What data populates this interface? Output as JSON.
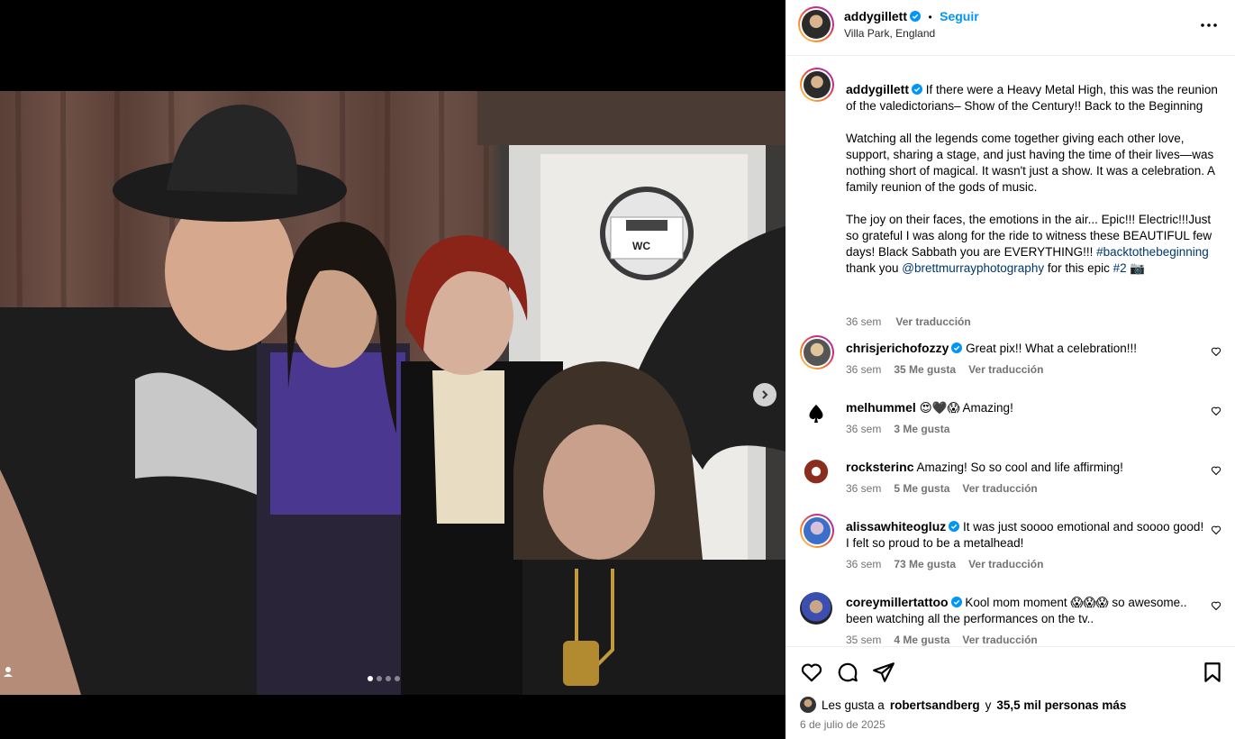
{
  "post": {
    "username": "addygillett",
    "separator": "•",
    "follow_label": "Seguir",
    "location": "Villa Park, England",
    "caption_p1": "If there were a Heavy Metal High, this was the reunion of the valedictorians– Show of the Century!! Back to the Beginning",
    "caption_p2": "Watching all the legends come together giving each other love, support, sharing a stage, and just having the time of their lives—was nothing short of magical. It wasn't just a show. It was a celebration. A family reunion of the gods of music.",
    "caption_p3a": "The joy on their faces, the emotions in the air... Epic!!! Electric!!!Just so grateful I was along for the ride to witness these BEAUTIFUL few days! Black Sabbath you are EVERYTHING!!! ",
    "hashtag1": "#backtothebeginning",
    "caption_p3b": " thank you ",
    "mention": "@brettmurrayphotography",
    "caption_p3c": " for this epic ",
    "hashtag2": "#2",
    "caption_emoji": " 📷",
    "caption_time": "36 sem",
    "caption_translate": "Ver traducción"
  },
  "photo": {
    "sign_text": "WC",
    "slide_count": 4,
    "active_slide": 1
  },
  "comments": [
    {
      "user": "chrisjerichofozzy",
      "verified": true,
      "text": "Great pix!! What a celebration!!!",
      "time": "36 sem",
      "likes": "35 Me gusta",
      "translate": "Ver traducción"
    },
    {
      "user": "melhummel",
      "verified": false,
      "text": "😍🖤😱 Amazing!",
      "time": "36 sem",
      "likes": "3 Me gusta",
      "translate": ""
    },
    {
      "user": "rocksterinc",
      "verified": false,
      "text": "Amazing! So so cool and life affirming!",
      "time": "36 sem",
      "likes": "5 Me gusta",
      "translate": "Ver traducción"
    },
    {
      "user": "alissawhiteogluz",
      "verified": true,
      "text": "It was just soooo emotional and soooo good! I felt so proud to be a metalhead!",
      "time": "36 sem",
      "likes": "73 Me gusta",
      "translate": "Ver traducción"
    },
    {
      "user": "coreymillertattoo",
      "verified": true,
      "text": "Kool mom moment 😱😱😱 so awesome.. been watching all the performances on the tv..",
      "time": "35 sem",
      "likes": "4 Me gusta",
      "translate": "Ver traducción"
    }
  ],
  "footer": {
    "likes_prefix": "Les gusta a",
    "likes_user": "robertsandberg",
    "likes_suffix": "y",
    "likes_count": "35,5 mil personas más",
    "date": "6 de julio de 2025"
  },
  "colors": {
    "link": "#00376b",
    "follow": "#0095f6",
    "verified": "#0095f6",
    "meta": "#737373"
  }
}
